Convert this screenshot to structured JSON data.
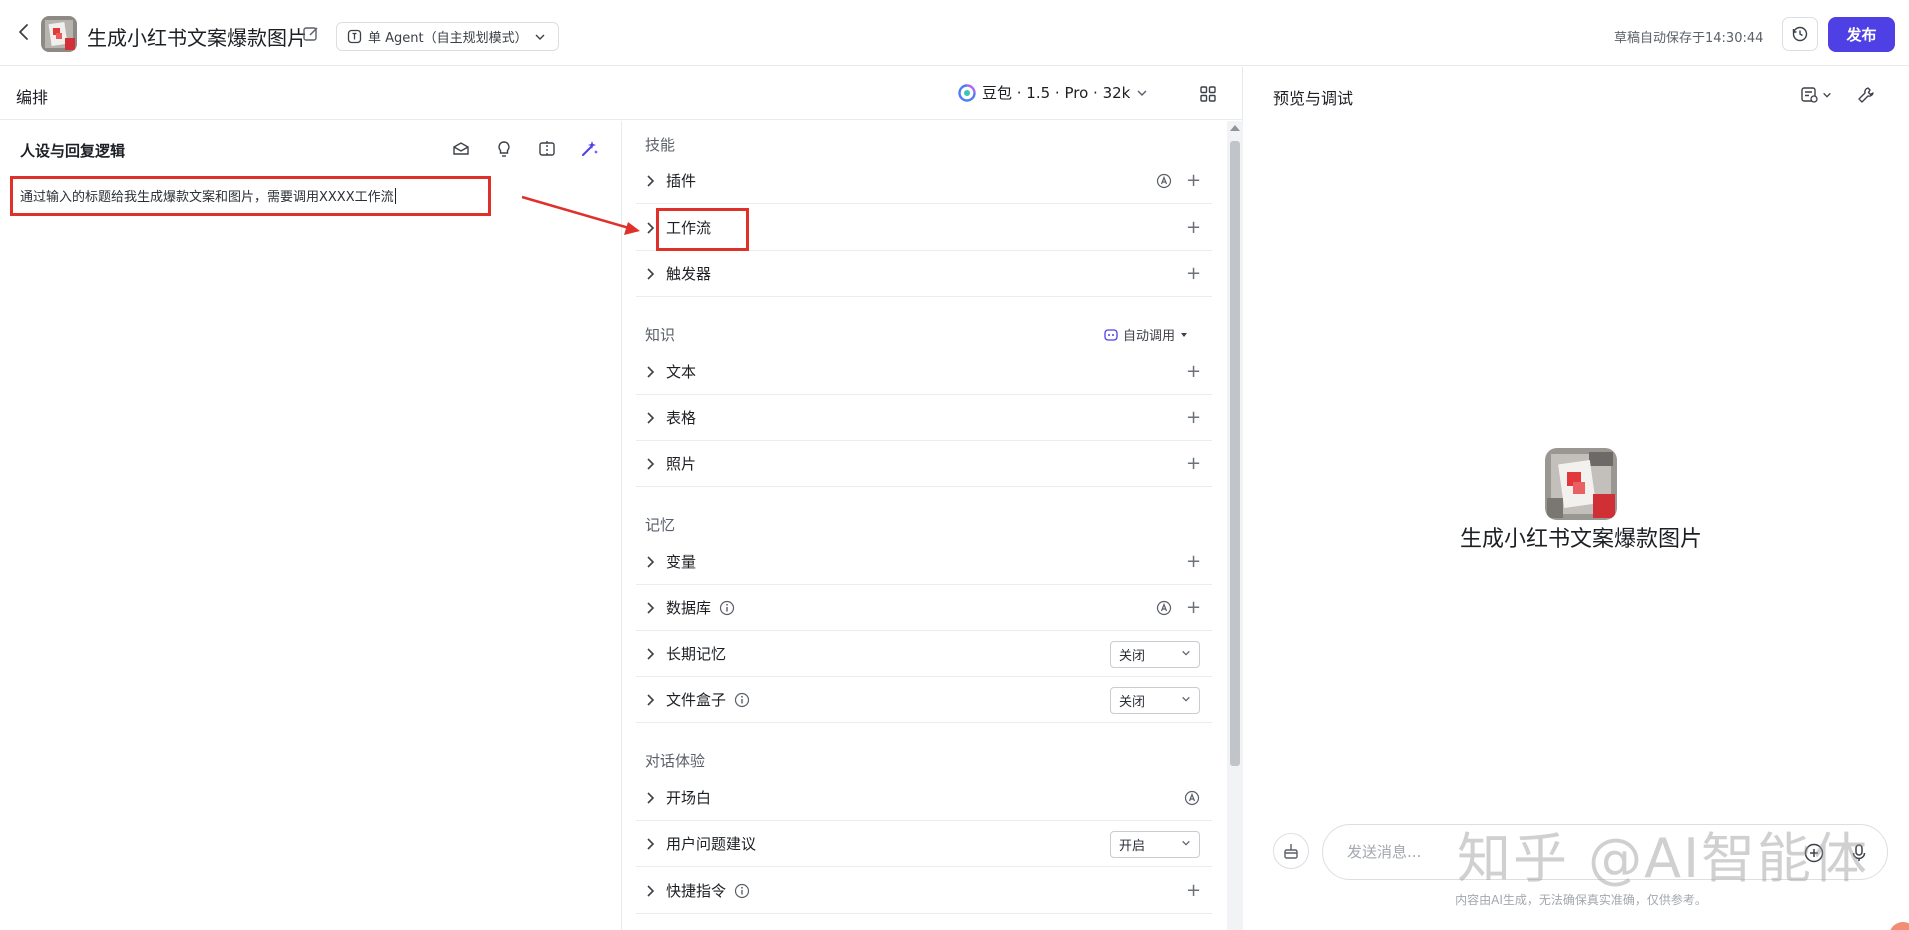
{
  "topbar": {
    "app_title": "生成小红书文案爆款图片",
    "mode_label": "单 Agent（自主规划模式）",
    "draft_status": "草稿自动保存于14:30:44",
    "publish_label": "发布"
  },
  "arrangement": {
    "title": "编排",
    "model_label": "豆包 · 1.5 · Pro · 32k"
  },
  "persona": {
    "title": "人设与回复逻辑",
    "prompt_text": "通过输入的标题给我生成爆款文案和图片，需要调用XXXX工作流"
  },
  "skills": {
    "title": "技能",
    "items": [
      {
        "label": "插件"
      },
      {
        "label": "工作流"
      },
      {
        "label": "触发器"
      }
    ]
  },
  "knowledge": {
    "title": "知识",
    "auto_call_label": "自动调用",
    "items": [
      {
        "label": "文本"
      },
      {
        "label": "表格"
      },
      {
        "label": "照片"
      }
    ]
  },
  "memory": {
    "title": "记忆",
    "items": [
      {
        "label": "变量"
      },
      {
        "label": "数据库"
      },
      {
        "label": "长期记忆",
        "value": "关闭"
      },
      {
        "label": "文件盒子",
        "value": "关闭"
      }
    ]
  },
  "dialog": {
    "title": "对话体验",
    "items": [
      {
        "label": "开场白"
      },
      {
        "label": "用户问题建议",
        "value": "开启"
      },
      {
        "label": "快捷指令"
      }
    ]
  },
  "preview": {
    "title": "预览与调试",
    "bot_name": "生成小红书文案爆款图片",
    "input_placeholder": "发送消息...",
    "disclaimer": "内容由AI生成，无法确保真实准确，仅供参考。",
    "watermark": "知乎 @AI智能体"
  },
  "colors": {
    "accent": "#4e40e5",
    "annotation_red": "#e0302a"
  }
}
